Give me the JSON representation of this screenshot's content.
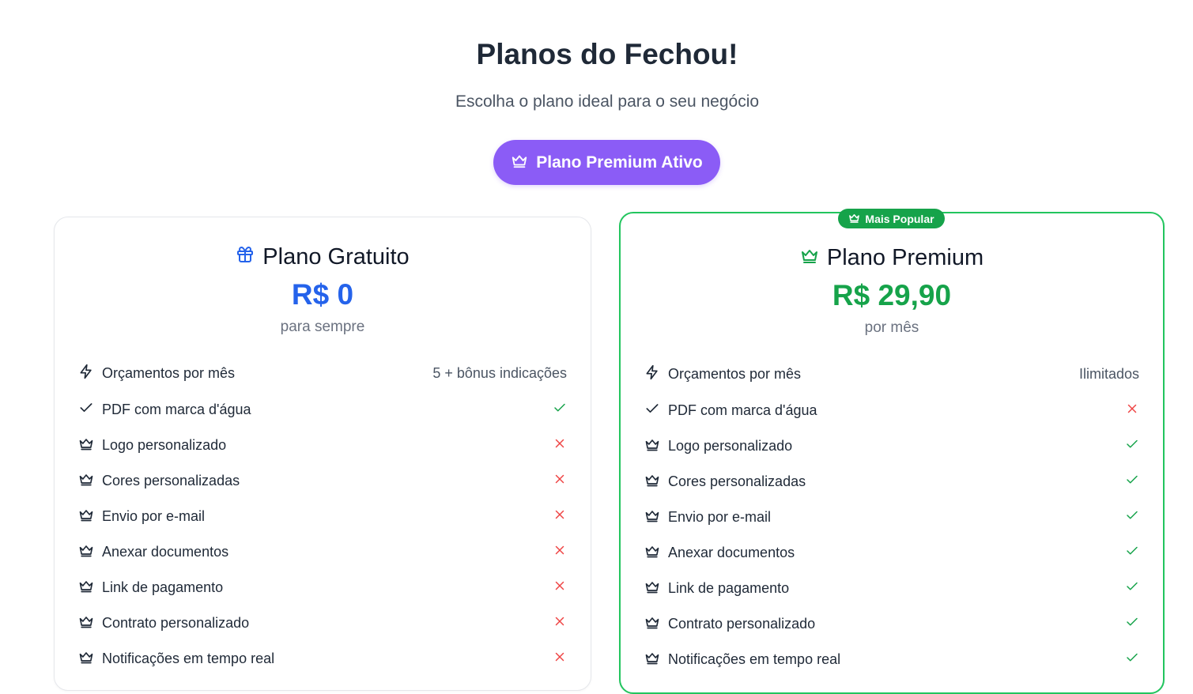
{
  "header": {
    "title": "Planos do Fechou!",
    "subtitle": "Escolha o plano ideal para o seu negócio",
    "active_button_label": "Plano Premium Ativo"
  },
  "colors": {
    "purple": "#8b5cf6",
    "blue": "#2563eb",
    "green": "#16a34a",
    "red": "#ef4444"
  },
  "plans": [
    {
      "name": "Plano Gratuito",
      "icon": "gift-icon",
      "price": "R$ 0",
      "period": "para sempre",
      "features": [
        {
          "icon": "lightning-icon",
          "label": "Orçamentos por mês",
          "value": "5 + bônus indicações"
        },
        {
          "icon": "check-icon",
          "label": "PDF com marca d'água",
          "included": true
        },
        {
          "icon": "crown-icon",
          "label": "Logo personalizado",
          "included": false
        },
        {
          "icon": "crown-icon",
          "label": "Cores personalizadas",
          "included": false
        },
        {
          "icon": "crown-icon",
          "label": "Envio por e-mail",
          "included": false
        },
        {
          "icon": "crown-icon",
          "label": "Anexar documentos",
          "included": false
        },
        {
          "icon": "crown-icon",
          "label": "Link de pagamento",
          "included": false
        },
        {
          "icon": "crown-icon",
          "label": "Contrato personalizado",
          "included": false
        },
        {
          "icon": "crown-icon",
          "label": "Notificações em tempo real",
          "included": false
        }
      ]
    },
    {
      "name": "Plano Premium",
      "icon": "crown-icon",
      "badge": "Mais Popular",
      "price": "R$ 29,90",
      "period": "por mês",
      "features": [
        {
          "icon": "lightning-icon",
          "label": "Orçamentos por mês",
          "value": "Ilimitados"
        },
        {
          "icon": "check-icon",
          "label": "PDF com marca d'água",
          "included": false
        },
        {
          "icon": "crown-icon",
          "label": "Logo personalizado",
          "included": true
        },
        {
          "icon": "crown-icon",
          "label": "Cores personalizadas",
          "included": true
        },
        {
          "icon": "crown-icon",
          "label": "Envio por e-mail",
          "included": true
        },
        {
          "icon": "crown-icon",
          "label": "Anexar documentos",
          "included": true
        },
        {
          "icon": "crown-icon",
          "label": "Link de pagamento",
          "included": true
        },
        {
          "icon": "crown-icon",
          "label": "Contrato personalizado",
          "included": true
        },
        {
          "icon": "crown-icon",
          "label": "Notificações em tempo real",
          "included": true
        }
      ]
    }
  ]
}
